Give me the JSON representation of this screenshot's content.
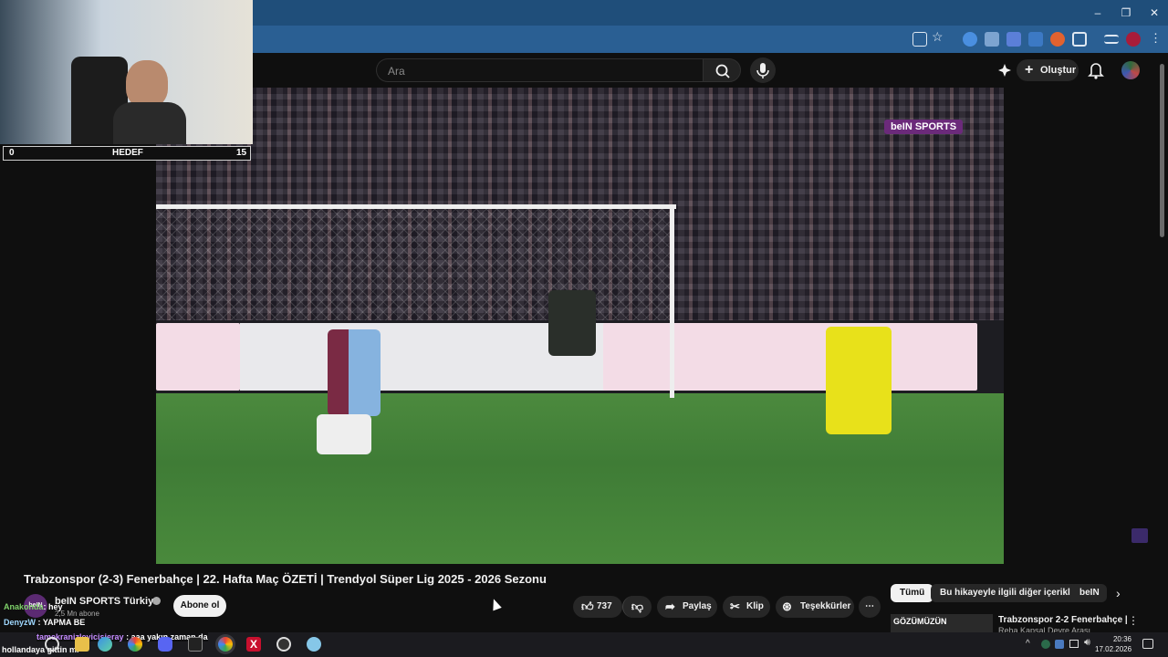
{
  "colors": {
    "accent": "#ff0000",
    "browser_bar": "#2a5f93",
    "bein_purple": "#6b2a7a"
  },
  "browser": {
    "window_controls": {
      "minimize": "–",
      "restore": "❐",
      "close": "✕"
    }
  },
  "overlay": {
    "goal": {
      "current": "0",
      "label": "HEDEF",
      "target": "15"
    }
  },
  "header": {
    "search_placeholder": "Ara",
    "create_label": "Oluştur",
    "icons": [
      "search-icon",
      "mic-icon",
      "create-icon",
      "bell-icon",
      "avatar"
    ]
  },
  "video": {
    "broadcaster_logo": "beIN SPORTS",
    "title": "Trabzonspor (2-3) Fenerbahçe | 22. Hafta Maç ÖZETİ | Trendyol Süper Lig 2025 - 2026 Sezonu"
  },
  "channel": {
    "avatar_text": "beIN",
    "name": "beIN SPORTS Türkiye",
    "subscribers": "2,5 Mn abone",
    "subscribe_label": "Abone ol"
  },
  "actions": {
    "like_count": "737",
    "share_label": "Paylaş",
    "clip_label": "Klip",
    "thanks_label": "Teşekkürler",
    "more_label": "⋯"
  },
  "chips": [
    "Tümü",
    "Bu hikayeyle ilgili diğer içerikler",
    "beIN S"
  ],
  "recommended": {
    "thumbnail_text": "GÖZÜMÜZÜN",
    "title": "Trabzonspor 2-2 Fenerbahçe |",
    "subtitle": "Reha Kapsal Devre Arası"
  },
  "chat": [
    {
      "user": "Anakonda",
      "msg": "hey"
    },
    {
      "user": "DenyzW",
      "msg": "YAPMA BE"
    },
    {
      "user": "tamekranizleyicisieray",
      "msg": "aaa yakın zaman da"
    },
    {
      "user": "",
      "msg": "hollandaya gittin mi"
    }
  ],
  "taskbar": {
    "time": "20:36",
    "date": "17.02.2026"
  }
}
